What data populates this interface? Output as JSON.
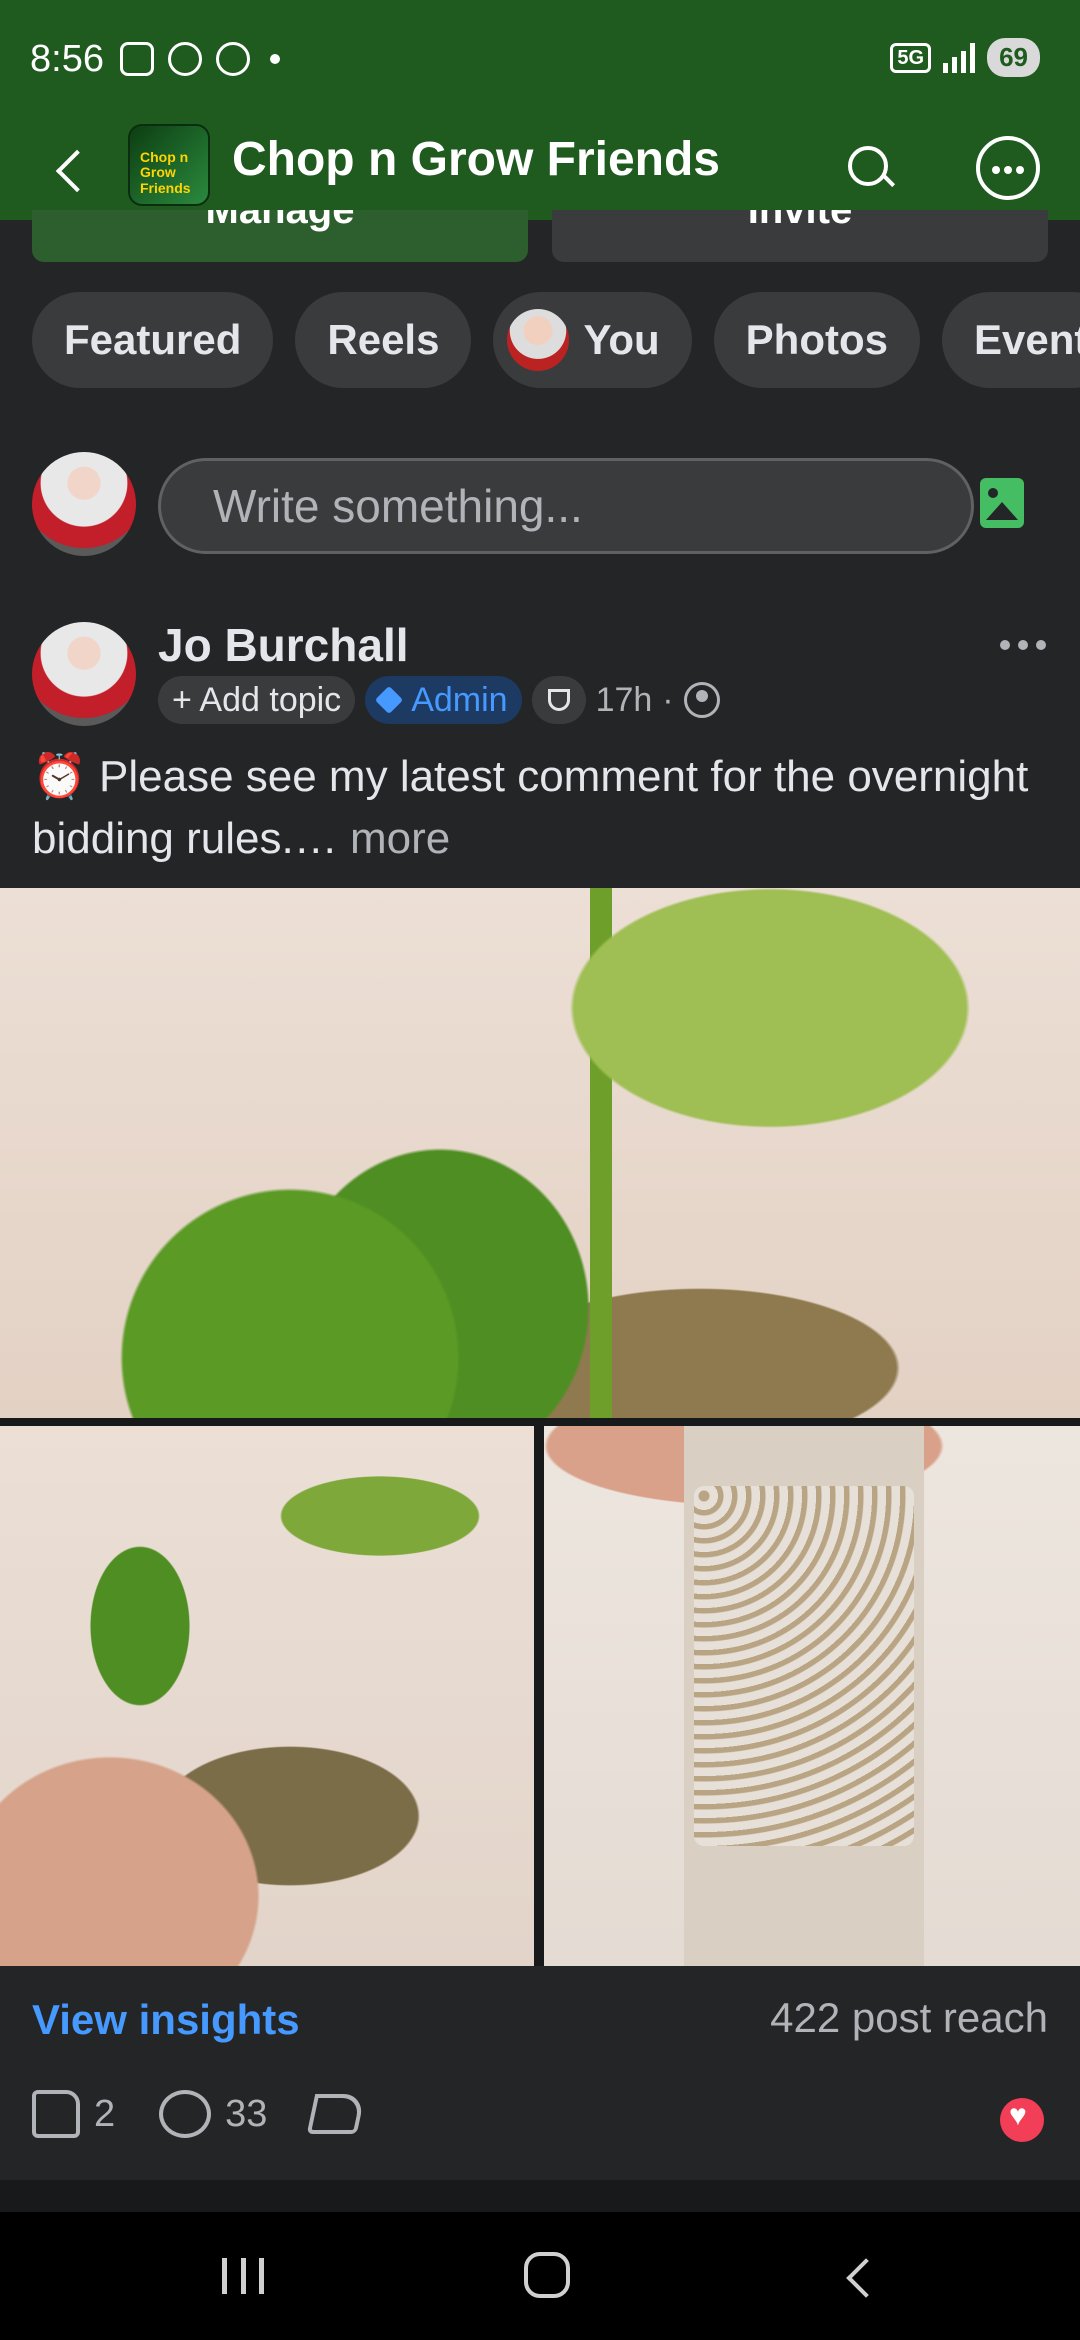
{
  "status": {
    "time": "8:56",
    "network": "5G",
    "battery": "69"
  },
  "header": {
    "title": "Chop n Grow Friends",
    "logo_text": "Chop n Grow Friends"
  },
  "top_buttons": {
    "manage": "Manage",
    "invite": "Invite"
  },
  "chips": [
    "Featured",
    "Reels",
    "You",
    "Photos",
    "Event"
  ],
  "composer": {
    "placeholder": "Write something..."
  },
  "post": {
    "author": "Jo Burchall",
    "add_topic": "+ Add topic",
    "role": "Admin",
    "time": "17h",
    "separator": "·",
    "text": "⏰ Please see my latest comment for the overnight bidding rules.…",
    "more": "more",
    "insights_link": "View insights",
    "reach": "422 post reach",
    "likes": "2",
    "comments": "33"
  },
  "colors": {
    "header_bg": "#1f5a1f",
    "accent_blue": "#4599ff",
    "feed_bg": "#242526",
    "love": "#f33e58"
  }
}
